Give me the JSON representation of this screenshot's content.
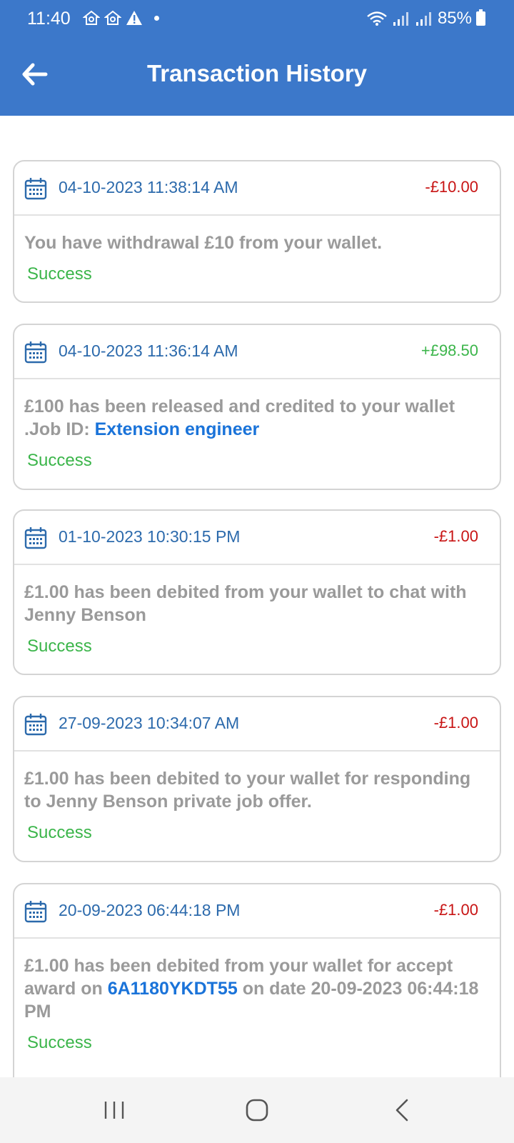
{
  "status_bar": {
    "time": "11:40",
    "battery": "85%"
  },
  "header": {
    "title": "Transaction History"
  },
  "transactions": [
    {
      "date": "04-10-2023 11:38:14 AM",
      "amount": "-£10.00",
      "direction": "debit",
      "desc": "You have withdrawal £10 from your wallet.",
      "status": "Success"
    },
    {
      "date": "04-10-2023 11:36:14 AM",
      "amount": "+£98.50",
      "direction": "credit",
      "desc_before": "£100 has been released and credited to your wallet .Job ID: ",
      "desc_link": "Extension engineer",
      "status": "Success"
    },
    {
      "date": "01-10-2023 10:30:15 PM",
      "amount": "-£1.00",
      "direction": "debit",
      "desc": "£1.00 has been debited from your wallet to chat with Jenny Benson",
      "status": "Success"
    },
    {
      "date": "27-09-2023 10:34:07 AM",
      "amount": "-£1.00",
      "direction": "debit",
      "desc": "£1.00 has been debited to your wallet for responding to Jenny Benson private job offer.",
      "status": "Success"
    },
    {
      "date": "20-09-2023 06:44:18 PM",
      "amount": "-£1.00",
      "direction": "debit",
      "desc_before": "£1.00 has been debited from your wallet for accept award on ",
      "desc_link": "6A1180YKDT55",
      "desc_after": " on date 20-09-2023 06:44:18 PM",
      "status": "Success"
    }
  ],
  "colors": {
    "brand": "#3c78ca",
    "debit": "#c81414",
    "credit": "#3bb54a",
    "success": "#3bb54a",
    "link": "#1a73d9"
  },
  "icons": {
    "back": "arrow-left-icon",
    "calendar": "calendar-icon",
    "nav_recents": "recents-icon",
    "nav_home": "home-icon",
    "nav_back": "chevron-left-icon"
  }
}
